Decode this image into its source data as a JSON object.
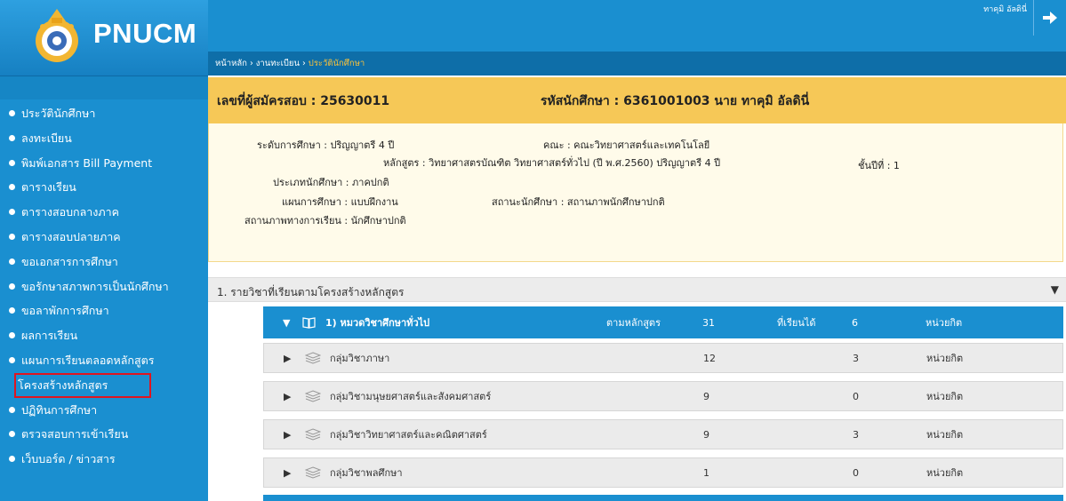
{
  "brand": {
    "name": "PNUCM"
  },
  "header": {
    "user_name": "ทาคุมิ อัลดินี่"
  },
  "breadcrumb": {
    "home": "หน้าหลัก",
    "sep1": " › ",
    "registration": "งานทะเบียน",
    "sep2": " › ",
    "current": "ประวัตินักศึกษา"
  },
  "sidebar": {
    "items": [
      {
        "label": "ประวัตินักศึกษา"
      },
      {
        "label": "ลงทะเบียน"
      },
      {
        "label": "พิมพ์เอกสาร Bill Payment"
      },
      {
        "label": "ตารางเรียน"
      },
      {
        "label": "ตารางสอบกลางภาค"
      },
      {
        "label": "ตารางสอบปลายภาค"
      },
      {
        "label": "ขอเอกสารการศึกษา"
      },
      {
        "label": "ขอรักษาสภาพการเป็นนักศึกษา"
      },
      {
        "label": "ขอลาพักการศึกษา"
      },
      {
        "label": "ผลการเรียน"
      },
      {
        "label": "แผนการเรียนตลอดหลักสูตร"
      },
      {
        "label": "โครงสร้างหลักสูตร"
      },
      {
        "label": "ปฏิทินการศึกษา"
      },
      {
        "label": "ตรวจสอบการเข้าเรียน"
      },
      {
        "label": "เว็บบอร์ด / ข่าวสาร"
      }
    ]
  },
  "student": {
    "applicant_label": "เลขที่ผู้สมัครสอบ : 25630011",
    "student_label": "รหัสนักศึกษา : 6361001003 นาย ทาคุมิ อัลดินี่",
    "level": "ระดับการศึกษา : ปริญญาตรี 4 ปี",
    "faculty": "คณะ : คณะวิทยาศาสตร์และเทคโนโลยี",
    "program": "หลักสูตร : วิทยาศาสตรบัณฑิต วิทยาศาสตร์ทั่วไป (ปี พ.ศ.2560) ปริญญาตรี 4 ปี",
    "year": "ชั้นปีที่ : 1",
    "type": "ประเภทนักศึกษา : ภาคปกติ",
    "plan": "แผนการศึกษา : แบบฝึกงาน",
    "status_student": "สถานะนักศึกษา : สถานภาพนักศึกษาปกติ",
    "status_study": "สถานภาพทางการเรียน : นักศึกษาปกติ"
  },
  "section": {
    "title": "1. รายวิชาที่เรียนตามโครงสร้างหลักสูตร",
    "arrow": "▼"
  },
  "group": {
    "toggle": "▼",
    "name": "1) หมวดวิชาศึกษาทั่วไป",
    "req_label": "ตามหลักสูตร",
    "req": "31",
    "got_label": "ที่เรียนได้",
    "got": "6",
    "unit": "หน่วยกิต"
  },
  "rows": [
    {
      "toggle": "▶",
      "name": "กลุ่มวิชาภาษา",
      "req": "12",
      "got": "3",
      "unit": "หน่วยกิต"
    },
    {
      "toggle": "▶",
      "name": "กลุ่มวิชามนุษยศาสตร์และสังคมศาสตร์",
      "req": "9",
      "got": "0",
      "unit": "หน่วยกิต"
    },
    {
      "toggle": "▶",
      "name": "กลุ่มวิชาวิทยาศาสตร์และคณิตศาสตร์",
      "req": "9",
      "got": "3",
      "unit": "หน่วยกิต"
    },
    {
      "toggle": "▶",
      "name": "กลุ่มวิชาพลศึกษา",
      "req": "1",
      "got": "0",
      "unit": "หน่วยกิต"
    }
  ],
  "colors": {
    "primary": "#1a8fd0",
    "dark": "#0e6ea8",
    "highlight": "#f6c857",
    "active_outline": "#e0151f"
  }
}
